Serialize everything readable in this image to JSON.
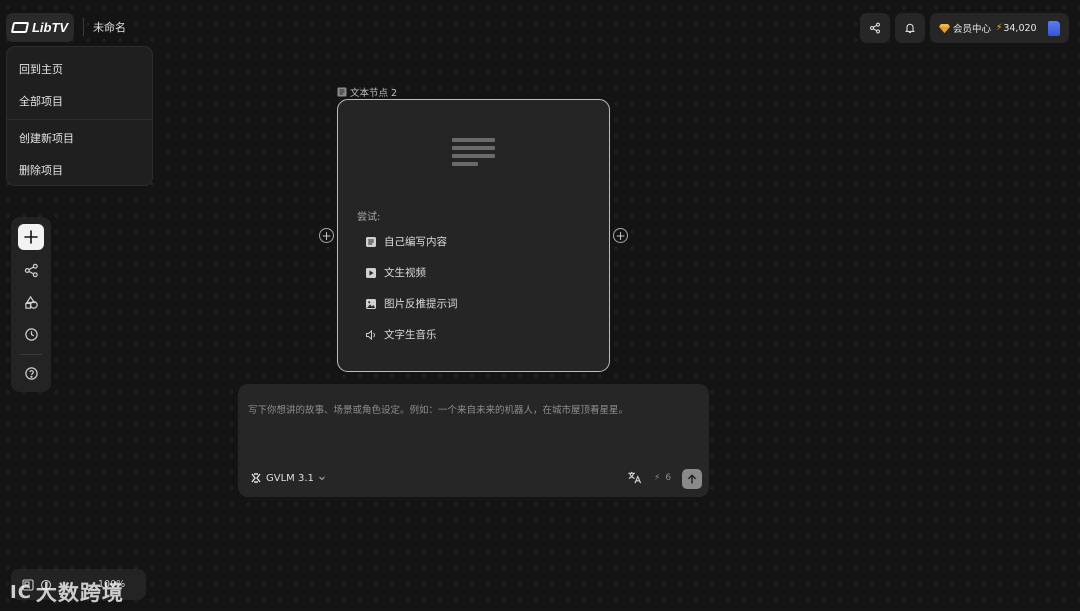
{
  "header": {
    "logo_text": "LibTV",
    "project_title": "未命名"
  },
  "menu": {
    "items": [
      "回到主页",
      "全部项目",
      "创建新项目",
      "删除项目"
    ]
  },
  "left_toolbar": {
    "icons": [
      "plus-icon",
      "workflow-icon",
      "shapes-icon",
      "history-icon",
      "help-icon"
    ]
  },
  "top_right": {
    "member_label": "会员中心",
    "credits": "34,020",
    "accent_color": "#f5c542"
  },
  "node": {
    "label": "文本节点 2",
    "try_label": "尝试:",
    "options": [
      "自己编写内容",
      "文生视频",
      "图片反推提示词",
      "文字生音乐"
    ]
  },
  "prompt": {
    "placeholder": "写下你想讲的故事、场景或角色设定。例如：一个来自未来的机器人，在城市屋顶看星星。",
    "model": "GVLM 3.1",
    "cost": "6"
  },
  "bottom_bar": {
    "zoom": "100%"
  },
  "watermark": {
    "text": "大数跨境"
  }
}
